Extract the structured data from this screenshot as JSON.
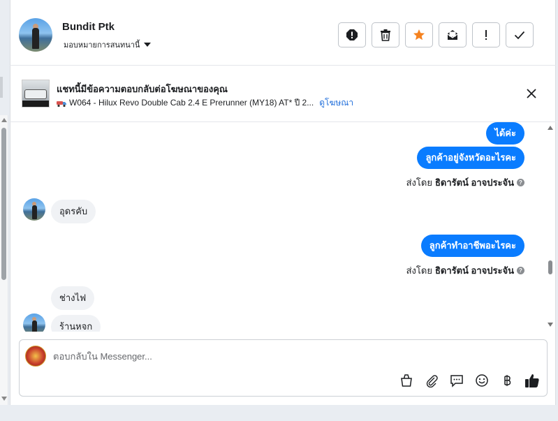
{
  "header": {
    "name": "Bundit Ptk",
    "assign_label": "มอบหมายการสนทนานี้"
  },
  "actions": [
    {
      "name": "spam-button",
      "icon": "alert-octagon-icon"
    },
    {
      "name": "delete-button",
      "icon": "trash-icon"
    },
    {
      "name": "star-button",
      "icon": "star-icon"
    },
    {
      "name": "unread-button",
      "icon": "envelope-icon"
    },
    {
      "name": "follow-up-button",
      "icon": "exclamation-icon"
    },
    {
      "name": "done-button",
      "icon": "check-icon"
    }
  ],
  "ad": {
    "title": "แชทนี้มีข้อความตอบกลับต่อโฆษณาของคุณ",
    "subtitle": "W064 - Hilux Revo Double Cab 2.4 E Prerunner (MY18) AT* ปี 2...",
    "link": "ดูโฆษณา"
  },
  "messages": {
    "out_1": "ได้ค่ะ",
    "out_2": "ลูกค้าอยู่จังหวัดอะไรคะ",
    "sent_by_prefix": "ส่งโดย",
    "sent_by_name": "ธิดารัตน์ อาจประจัน",
    "in_1": "อุดรคับ",
    "out_3": "ลูกค้าทำอาชีพอะไรคะ",
    "in_2": "ช่างไฟ",
    "in_3": "ร้านหจก"
  },
  "composer": {
    "placeholder": "ตอบกลับใน Messenger..."
  },
  "colors": {
    "accent": "#0a7cff",
    "star": "#f5821f",
    "link": "#216fdb"
  }
}
